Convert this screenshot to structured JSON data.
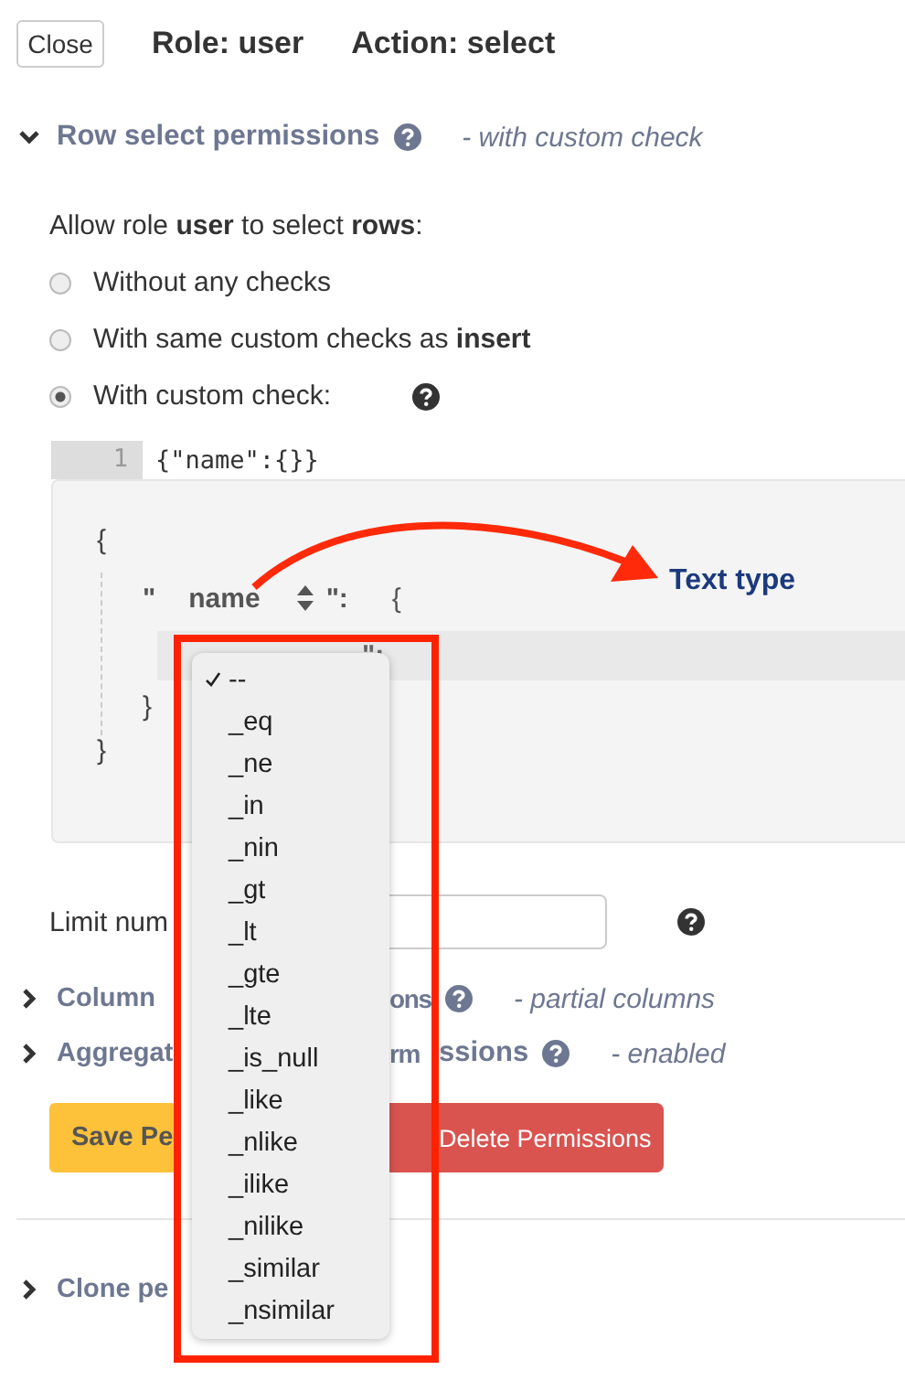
{
  "header": {
    "close_button": "Close",
    "role": "Role: user",
    "action": "Action: select"
  },
  "row_section": {
    "title": "Row select permissions",
    "expanded": true,
    "note": "- with custom check",
    "allow_text": "Allow role **user** to select **rows**:",
    "options": [
      {
        "label": "Without any checks",
        "selected": false
      },
      {
        "label": "With same custom checks as **insert**",
        "selected": false
      },
      {
        "label": "With custom check:",
        "selected": true
      }
    ],
    "code": {
      "line_number": "1",
      "text": "{\"name\":{}}"
    },
    "builder": {
      "open_brace": "{",
      "quote": "\"",
      "field": "name",
      "colon": "\":",
      "inner_open": "{",
      "inner_colon": "\":",
      "inner_close": "}",
      "close_brace": "}"
    }
  },
  "annotation": {
    "label": "Text type"
  },
  "operator_menu": {
    "items": [
      {
        "label": "--",
        "selected": true
      },
      {
        "label": "_eq",
        "selected": false
      },
      {
        "label": "_ne",
        "selected": false
      },
      {
        "label": "_in",
        "selected": false
      },
      {
        "label": "_nin",
        "selected": false
      },
      {
        "label": "_gt",
        "selected": false
      },
      {
        "label": "_lt",
        "selected": false
      },
      {
        "label": "_gte",
        "selected": false
      },
      {
        "label": "_lte",
        "selected": false
      },
      {
        "label": "_is_null",
        "selected": false
      },
      {
        "label": "_like",
        "selected": false
      },
      {
        "label": "_nlike",
        "selected": false
      },
      {
        "label": "_ilike",
        "selected": false
      },
      {
        "label": "_nilike",
        "selected": false
      },
      {
        "label": "_similar",
        "selected": false
      },
      {
        "label": "_nsimilar",
        "selected": false
      }
    ]
  },
  "limit": {
    "label": "Limit num"
  },
  "sections": [
    {
      "title_left": "Column",
      "title_parts": [
        "ons"
      ],
      "note": "- partial columns",
      "expanded": false
    },
    {
      "title_left": "Aggregat",
      "title_parts": [
        "rm",
        "ssions"
      ],
      "note": "- enabled",
      "expanded": false
    }
  ],
  "buttons": [
    {
      "kind": "save",
      "label": "Save Pe"
    },
    {
      "kind": "delete",
      "label": "Delete Permissions"
    }
  ],
  "clone_section": {
    "title": "Clone pe",
    "expanded": false
  }
}
